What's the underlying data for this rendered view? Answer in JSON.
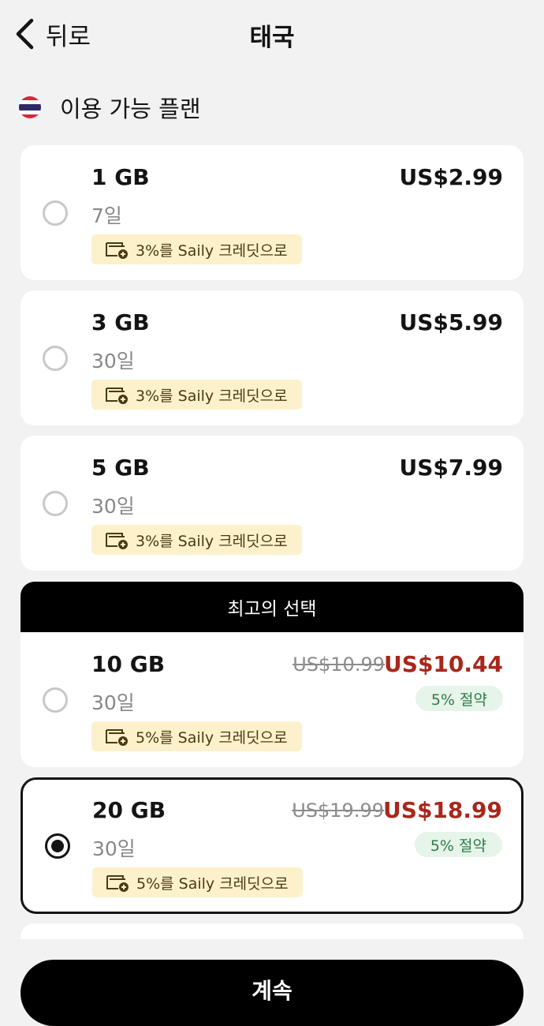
{
  "header": {
    "back_label": "뒤로",
    "title": "태국"
  },
  "section": {
    "title": "이용 가능 플랜",
    "flag_icon": "thailand-flag-icon"
  },
  "plans": [
    {
      "size": "1 GB",
      "duration": "7일",
      "price": "US$2.99",
      "credit": "3%를 Saily 크레딧으로",
      "selected": false
    },
    {
      "size": "3 GB",
      "duration": "30일",
      "price": "US$5.99",
      "credit": "3%를 Saily 크레딧으로",
      "selected": false
    },
    {
      "size": "5 GB",
      "duration": "30일",
      "price": "US$7.99",
      "credit": "3%를 Saily 크레딧으로",
      "selected": false
    },
    {
      "best_choice_label": "최고의 선택",
      "size": "10 GB",
      "duration": "30일",
      "old_price": "US$10.99",
      "price": "US$10.44",
      "discount": "5% 절약",
      "credit": "5%를 Saily 크레딧으로",
      "selected": false
    },
    {
      "size": "20 GB",
      "duration": "30일",
      "old_price": "US$19.99",
      "price": "US$18.99",
      "discount": "5% 절약",
      "credit": "5%를 Saily 크레딧으로",
      "selected": true
    }
  ],
  "footer": {
    "continue_label": "계속"
  },
  "colors": {
    "background": "#f2f2f2",
    "card": "#ffffff",
    "accent_dark": "#000000",
    "discount_price": "#a8271c",
    "discount_badge_bg": "#e6f4ea",
    "discount_badge_text": "#2e7d4a",
    "credit_badge_bg": "#fdf1cc"
  }
}
